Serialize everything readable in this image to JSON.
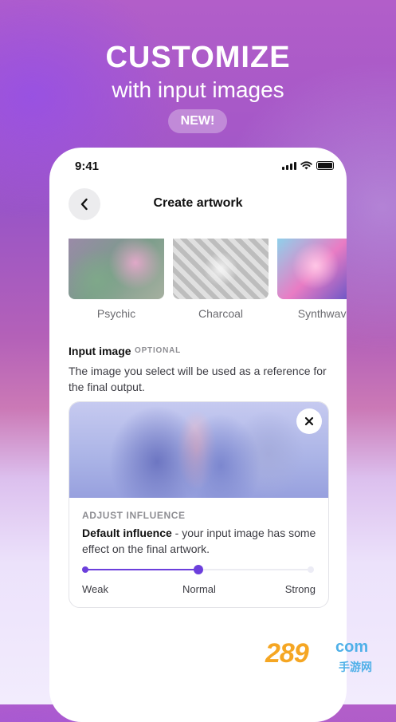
{
  "promo": {
    "headline": "CUSTOMIZE",
    "subheadline": "with input images",
    "badge": "NEW!"
  },
  "status_bar": {
    "time": "9:41"
  },
  "nav": {
    "title": "Create artwork",
    "back_icon": "chevron-left-icon"
  },
  "styles": [
    {
      "label": "Psychic"
    },
    {
      "label": "Charcoal"
    },
    {
      "label": "Synthwave"
    }
  ],
  "input_image": {
    "title": "Input image",
    "optional_tag": "OPTIONAL",
    "description": "The image you select will be used as a reference for the final output.",
    "close_icon": "close-icon"
  },
  "influence": {
    "label": "ADJUST INFLUENCE",
    "setting_name": "Default influence",
    "setting_desc": " - your input image has some effect on the final artwork.",
    "level": 0.5,
    "ticks": [
      "Weak",
      "Normal",
      "Strong"
    ],
    "accent_color": "#6c3fdc"
  },
  "watermark": {
    "number": "289",
    "suffix": "com",
    "cn": "手游网"
  }
}
